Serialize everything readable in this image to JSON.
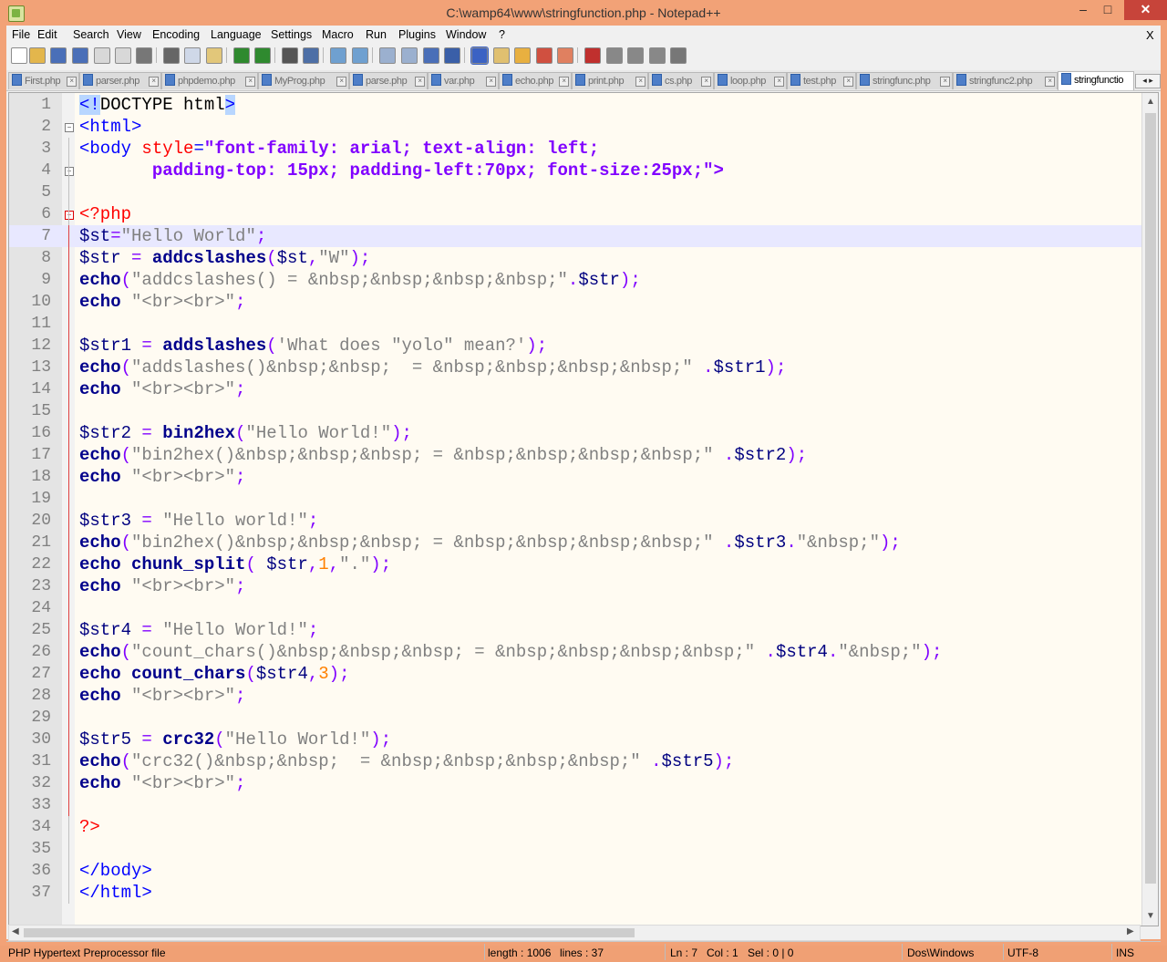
{
  "window": {
    "title": "C:\\wamp64\\www\\stringfunction.php - Notepad++",
    "min": "–",
    "max": "□",
    "close": "✕"
  },
  "menu": [
    "File",
    "Edit",
    "Search",
    "View",
    "Encoding",
    "Language",
    "Settings",
    "Macro",
    "Run",
    "Plugins",
    "Window",
    "?"
  ],
  "menu_close": "X",
  "tabs": [
    "First.php",
    "parser.php",
    "phpdemo.php",
    "MyProg.php",
    "parse.php",
    "var.php",
    "echo.php",
    "print.php",
    "cs.php",
    "loop.php",
    "test.php",
    "stringfunc.php",
    "stringfunc2.php",
    "stringfunctio"
  ],
  "tab_scroll": "◂ ▸",
  "active_tab": 13,
  "lines": [
    [
      [
        "<!",
        "tg hl"
      ],
      [
        "DOCTYPE html",
        ""
      ],
      [
        ">",
        "tg hl"
      ]
    ],
    [
      [
        "<html>",
        "tg"
      ]
    ],
    [
      [
        "<body ",
        "tg"
      ],
      [
        "style",
        "at"
      ],
      [
        "=",
        "tg"
      ],
      [
        "\"font-family: arial; text-align: left;",
        "av"
      ]
    ],
    [
      [
        "       padding-top: 15px; padding-left:70px; font-size:25px;\">",
        "av"
      ]
    ],
    [],
    [
      [
        "<?php",
        "ph"
      ]
    ],
    [
      [
        "$st",
        "v"
      ],
      [
        "=",
        "o"
      ],
      [
        "\"Hello World\"",
        "s"
      ],
      [
        ";",
        "o"
      ]
    ],
    [
      [
        "$str ",
        "v"
      ],
      [
        "= ",
        "o"
      ],
      [
        "addcslashes",
        "k"
      ],
      [
        "(",
        "o"
      ],
      [
        "$st",
        "v"
      ],
      [
        ",",
        "o"
      ],
      [
        "\"W\"",
        "s"
      ],
      [
        ");",
        "o"
      ]
    ],
    [
      [
        "echo",
        "k"
      ],
      [
        "(",
        "o"
      ],
      [
        "\"addcslashes() = &nbsp;&nbsp;&nbsp;&nbsp;\"",
        "s"
      ],
      [
        ".",
        "o"
      ],
      [
        "$str",
        "v"
      ],
      [
        ");",
        "o"
      ]
    ],
    [
      [
        "echo ",
        "k"
      ],
      [
        "\"<br><br>\"",
        "s"
      ],
      [
        ";",
        "o"
      ]
    ],
    [],
    [
      [
        "$str1 ",
        "v"
      ],
      [
        "= ",
        "o"
      ],
      [
        "addslashes",
        "k"
      ],
      [
        "(",
        "o"
      ],
      [
        "'What does \"yolo\" mean?'",
        "s"
      ],
      [
        ");",
        "o"
      ]
    ],
    [
      [
        "echo",
        "k"
      ],
      [
        "(",
        "o"
      ],
      [
        "\"addslashes()&nbsp;&nbsp;  = &nbsp;&nbsp;&nbsp;&nbsp;\" ",
        "s"
      ],
      [
        ".",
        "o"
      ],
      [
        "$str1",
        "v"
      ],
      [
        ");",
        "o"
      ]
    ],
    [
      [
        "echo ",
        "k"
      ],
      [
        "\"<br><br>\"",
        "s"
      ],
      [
        ";",
        "o"
      ]
    ],
    [],
    [
      [
        "$str2 ",
        "v"
      ],
      [
        "= ",
        "o"
      ],
      [
        "bin2hex",
        "k"
      ],
      [
        "(",
        "o"
      ],
      [
        "\"Hello World!\"",
        "s"
      ],
      [
        ");",
        "o"
      ]
    ],
    [
      [
        "echo",
        "k"
      ],
      [
        "(",
        "o"
      ],
      [
        "\"bin2hex()&nbsp;&nbsp;&nbsp; = &nbsp;&nbsp;&nbsp;&nbsp;\" ",
        "s"
      ],
      [
        ".",
        "o"
      ],
      [
        "$str2",
        "v"
      ],
      [
        ");",
        "o"
      ]
    ],
    [
      [
        "echo ",
        "k"
      ],
      [
        "\"<br><br>\"",
        "s"
      ],
      [
        ";",
        "o"
      ]
    ],
    [],
    [
      [
        "$str3 ",
        "v"
      ],
      [
        "= ",
        "o"
      ],
      [
        "\"Hello world!\"",
        "s"
      ],
      [
        ";",
        "o"
      ]
    ],
    [
      [
        "echo",
        "k"
      ],
      [
        "(",
        "o"
      ],
      [
        "\"bin2hex()&nbsp;&nbsp;&nbsp; = &nbsp;&nbsp;&nbsp;&nbsp;\" ",
        "s"
      ],
      [
        ".",
        "o"
      ],
      [
        "$str3",
        "v"
      ],
      [
        ".",
        "o"
      ],
      [
        "\"&nbsp;\"",
        "s"
      ],
      [
        ");",
        "o"
      ]
    ],
    [
      [
        "echo ",
        "k"
      ],
      [
        "chunk_split",
        "k"
      ],
      [
        "( ",
        "o"
      ],
      [
        "$str",
        "v"
      ],
      [
        ",",
        "o"
      ],
      [
        "1",
        "nm"
      ],
      [
        ",",
        "o"
      ],
      [
        "\".\"",
        "s"
      ],
      [
        ");",
        "o"
      ]
    ],
    [
      [
        "echo ",
        "k"
      ],
      [
        "\"<br><br>\"",
        "s"
      ],
      [
        ";",
        "o"
      ]
    ],
    [],
    [
      [
        "$str4 ",
        "v"
      ],
      [
        "= ",
        "o"
      ],
      [
        "\"Hello World!\"",
        "s"
      ],
      [
        ";",
        "o"
      ]
    ],
    [
      [
        "echo",
        "k"
      ],
      [
        "(",
        "o"
      ],
      [
        "\"count_chars()&nbsp;&nbsp;&nbsp; = &nbsp;&nbsp;&nbsp;&nbsp;\" ",
        "s"
      ],
      [
        ".",
        "o"
      ],
      [
        "$str4",
        "v"
      ],
      [
        ".",
        "o"
      ],
      [
        "\"&nbsp;\"",
        "s"
      ],
      [
        ");",
        "o"
      ]
    ],
    [
      [
        "echo ",
        "k"
      ],
      [
        "count_chars",
        "k"
      ],
      [
        "(",
        "o"
      ],
      [
        "$str4",
        "v"
      ],
      [
        ",",
        "o"
      ],
      [
        "3",
        "nm"
      ],
      [
        ");",
        "o"
      ]
    ],
    [
      [
        "echo ",
        "k"
      ],
      [
        "\"<br><br>\"",
        "s"
      ],
      [
        ";",
        "o"
      ]
    ],
    [],
    [
      [
        "$str5 ",
        "v"
      ],
      [
        "= ",
        "o"
      ],
      [
        "crc32",
        "k"
      ],
      [
        "(",
        "o"
      ],
      [
        "\"Hello World!\"",
        "s"
      ],
      [
        ");",
        "o"
      ]
    ],
    [
      [
        "echo",
        "k"
      ],
      [
        "(",
        "o"
      ],
      [
        "\"crc32()&nbsp;&nbsp;  = &nbsp;&nbsp;&nbsp;&nbsp;\" ",
        "s"
      ],
      [
        ".",
        "o"
      ],
      [
        "$str5",
        "v"
      ],
      [
        ");",
        "o"
      ]
    ],
    [
      [
        "echo ",
        "k"
      ],
      [
        "\"<br><br>\"",
        "s"
      ],
      [
        ";",
        "o"
      ]
    ],
    [],
    [
      [
        "?>",
        "ph"
      ]
    ],
    [],
    [
      [
        "</body>",
        "tg"
      ]
    ],
    [
      [
        "</html>",
        "tg"
      ]
    ]
  ],
  "current_line": 7,
  "status": {
    "filetype": "PHP Hypertext Preprocessor file",
    "length": "length : 1006",
    "lines": "lines : 37",
    "ln": "Ln : 7",
    "col": "Col : 1",
    "sel": "Sel : 0 | 0",
    "eol": "Dos\\Windows",
    "encoding": "UTF-8",
    "mode": "INS"
  },
  "icons": [
    "new-file-icon",
    "open-file-icon",
    "save-icon",
    "save-all-icon",
    "close-icon",
    "close-all-icon",
    "print-icon",
    "cut-icon",
    "copy-icon",
    "paste-icon",
    "undo-icon",
    "redo-icon",
    "find-icon",
    "replace-icon",
    "zoom-in-icon",
    "zoom-out-icon",
    "sync-vertical-icon",
    "sync-horizontal-icon",
    "word-wrap-icon",
    "show-all-chars-icon",
    "indent-guide-icon",
    "doc-map-icon",
    "function-list-icon",
    "folder-as-workspace-icon",
    "monitoring-icon",
    "record-macro-icon",
    "stop-macro-icon",
    "play-macro-icon",
    "run-macro-multiple-icon",
    "save-macro-icon"
  ]
}
